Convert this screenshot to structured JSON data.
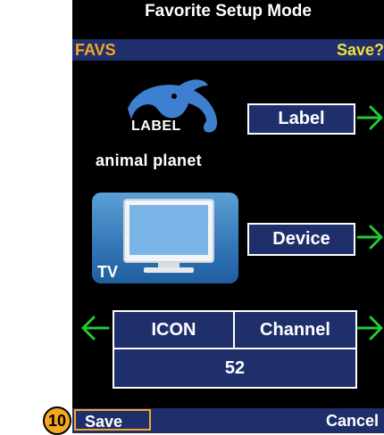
{
  "window": {
    "title": "Favorite Setup Mode"
  },
  "subbar": {
    "left": "FAVS",
    "right": "Save?"
  },
  "logo": {
    "overlay_label": "LABEL",
    "brand_text": "animal planet"
  },
  "buttons": {
    "label": "Label",
    "device": "Device"
  },
  "tv": {
    "label": "TV"
  },
  "channel_box": {
    "icon_header": "ICON",
    "channel_header": "Channel",
    "channel_value": "52"
  },
  "bottom": {
    "save": "Save",
    "cancel": "Cancel"
  },
  "step_badge": "10",
  "colors": {
    "bar_blue": "#1f2f6b",
    "orange": "#f5a623",
    "yellow": "#f3e03a",
    "arrow_green": "#22cc33"
  }
}
